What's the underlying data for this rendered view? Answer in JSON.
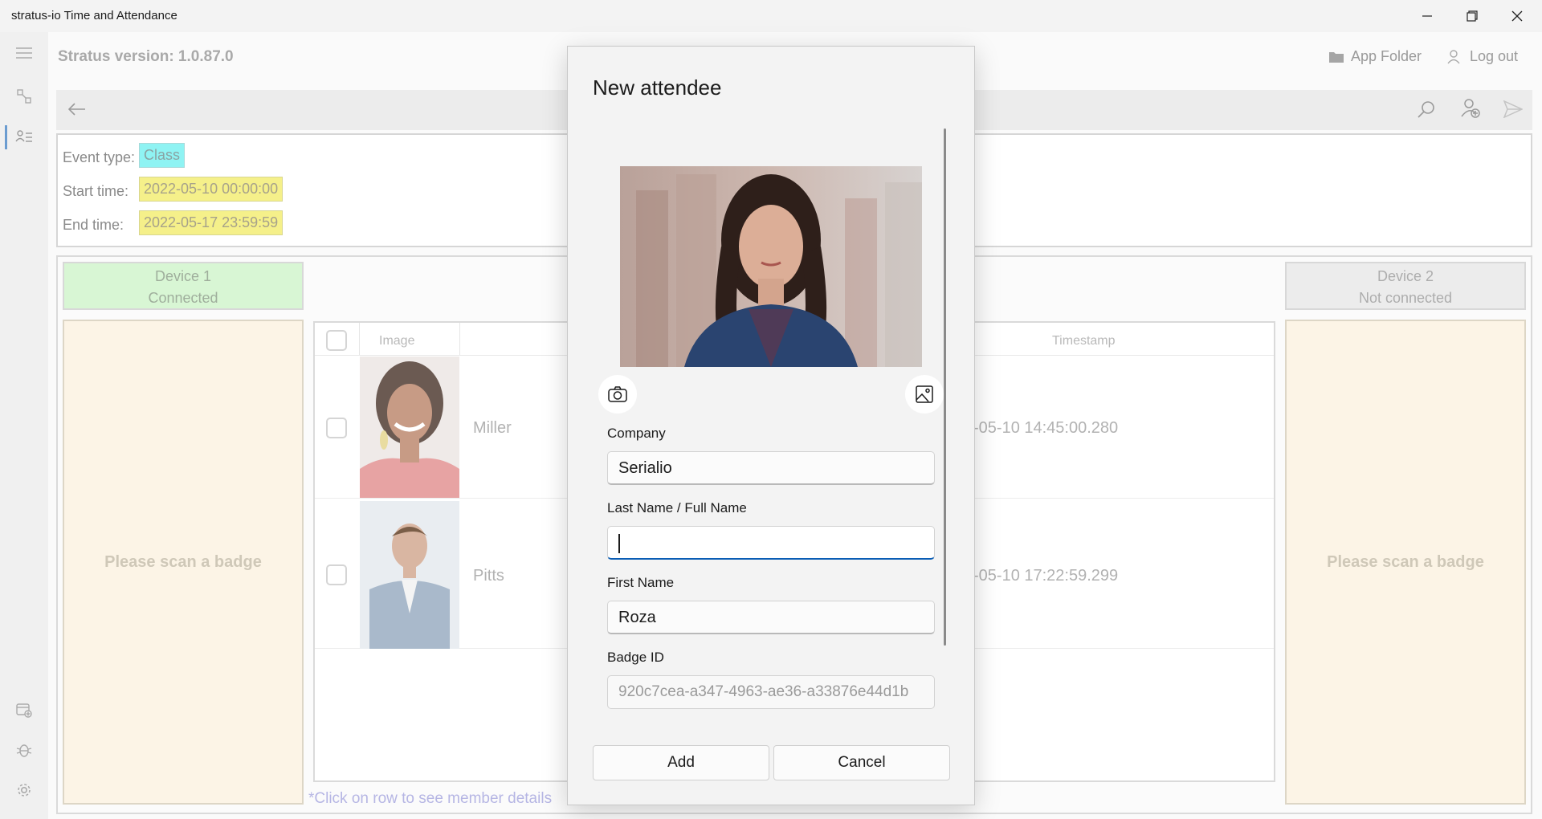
{
  "window": {
    "title": "stratus-io Time and Attendance",
    "controls": [
      "minimize-icon",
      "restore-icon",
      "close-icon"
    ]
  },
  "header": {
    "version_text": "Stratus version: 1.0.87.0",
    "app_folder_label": "App Folder",
    "logout_label": "Log out"
  },
  "event": {
    "type_label": "Event type:",
    "type_value": "Class",
    "start_label": "Start time:",
    "start_value": "2022-05-10 00:00:00",
    "end_label": "End time:",
    "end_value": "2022-05-17 23:59:59"
  },
  "devices": [
    {
      "name": "Device 1",
      "status": "Connected",
      "scan_prompt": "Please scan a badge",
      "color": "#d8f6d4"
    },
    {
      "name": "Device 2",
      "status": "Not connected",
      "scan_prompt": "Please scan a badge",
      "color": "#ececec"
    }
  ],
  "table": {
    "columns": [
      "Image",
      "Timestamp"
    ],
    "rows": [
      {
        "name": "Miller",
        "timestamp": "-05-10 14:45:00.280"
      },
      {
        "name": "Pitts",
        "timestamp": "-05-10 17:22:59.299"
      }
    ]
  },
  "footnote": "*Click on row to see member details",
  "dialog": {
    "title": "New attendee",
    "company_label": "Company",
    "company_value": "Serialio",
    "last_name_label": "Last Name / Full Name",
    "last_name_value": "",
    "first_name_label": "First Name",
    "first_name_value": "Roza",
    "badge_label": "Badge ID",
    "badge_value": "920c7cea-a347-4963-ae36-a33876e44d1b",
    "add_label": "Add",
    "cancel_label": "Cancel"
  },
  "colors": {
    "accent": "#0a5db5",
    "event_type_bg": "#8ff3f3",
    "time_bg": "#f5f08a",
    "scan_bg": "#fcf4e6"
  }
}
